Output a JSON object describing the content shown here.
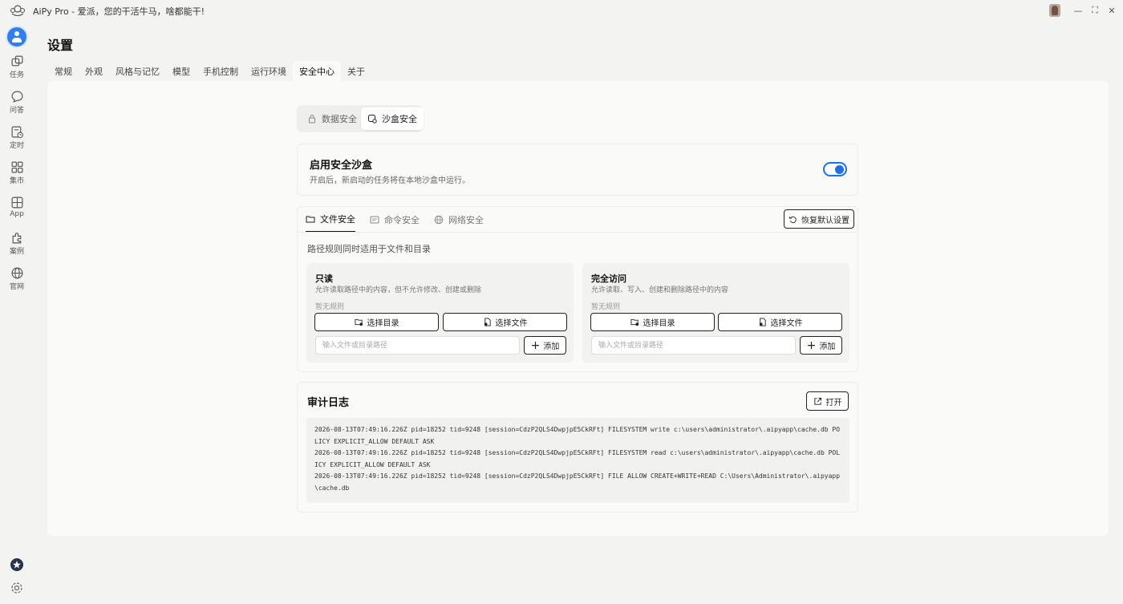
{
  "window": {
    "title": "AiPy Pro  -  爱派，您的干活牛马，啥都能干!",
    "minimize_glyph": "—",
    "maximize_glyph": "⛶",
    "close_glyph": "✕"
  },
  "sidebar": {
    "items": [
      {
        "label": "任务",
        "icon": "cube-icon"
      },
      {
        "label": "问答",
        "icon": "chat-icon"
      },
      {
        "label": "定时",
        "icon": "schedule-icon"
      },
      {
        "label": "集市",
        "icon": "grid-icon"
      },
      {
        "label": "App",
        "icon": "apps-icon"
      },
      {
        "label": "案例",
        "icon": "puzzle-icon"
      },
      {
        "label": "官网",
        "icon": "globe-icon"
      }
    ]
  },
  "page": {
    "title": "设置"
  },
  "tabs": [
    {
      "label": "常规"
    },
    {
      "label": "外观"
    },
    {
      "label": "风格与记忆"
    },
    {
      "label": "模型"
    },
    {
      "label": "手机控制"
    },
    {
      "label": "运行环境"
    },
    {
      "label": "安全中心",
      "active": true
    },
    {
      "label": "关于"
    }
  ],
  "segment": {
    "data_security": "数据安全",
    "sandbox_security": "沙盒安全"
  },
  "sandbox": {
    "title": "启用安全沙盒",
    "description": "开启后，新启动的任务将在本地沙盒中运行。",
    "enabled": true
  },
  "security": {
    "subtabs": [
      "文件安全",
      "命令安全",
      "网络安全"
    ],
    "reset_label": "恢复默认设置",
    "path_note": "路径规则同时适用于文件和目录",
    "readonly": {
      "title": "只读",
      "description": "允许读取路径中的内容，但不允许修改、创建或删除",
      "empty": "暂无规则",
      "select_dir": "选择目录",
      "select_file": "选择文件",
      "placeholder": "输入文件或目录路径",
      "add": "添加"
    },
    "full": {
      "title": "完全访问",
      "description": "允许读取、写入、创建和删除路径中的内容",
      "empty": "暂无规则",
      "select_dir": "选择目录",
      "select_file": "选择文件",
      "placeholder": "输入文件或目录路径",
      "add": "添加"
    }
  },
  "audit": {
    "title": "审计日志",
    "open_label": "打开",
    "lines": [
      "2026-08-13T07:49:16.226Z pid=18252 tid=9248 [session=CdzP2QLS4DwpjpE5CkRFt] FILESYSTEM write c:\\users\\administrator\\.aipyapp\\cache.db POLICY EXPLICIT_ALLOW DEFAULT ASK",
      "2026-08-13T07:49:16.226Z pid=18252 tid=9248 [session=CdzP2QLS4DwpjpE5CkRFt] FILESYSTEM read c:\\users\\administrator\\.aipyapp\\cache.db POLICY EXPLICIT_ALLOW DEFAULT ASK",
      "2026-08-13T07:49:16.226Z pid=18252 tid=9248 [session=CdzP2QLS4DwpjpE5CkRFt] FILE ALLOW CREATE+WRITE+READ C:\\Users\\Administrator\\.aipyapp\\cache.db"
    ]
  },
  "colors": {
    "accent": "#1f6fe5",
    "background": "#f3f3f1",
    "panel": "#fafaf8"
  }
}
